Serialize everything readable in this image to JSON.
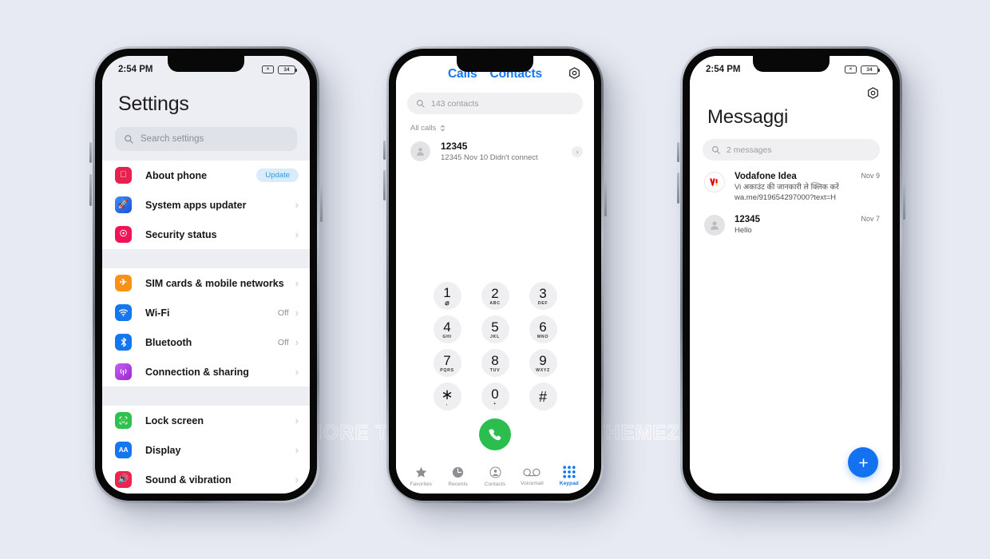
{
  "background_color": "#e7eaf2",
  "watermark": {
    "text": "FOR MORE THEMES VISIT - MIUITHEMEZ.COM"
  },
  "phone1": {
    "status": {
      "time": "2:54 PM",
      "mute_icon": "mute-icon",
      "battery_level": "34"
    },
    "title": "Settings",
    "search": {
      "placeholder": "Search settings",
      "icon": "search-icon"
    },
    "groups": [
      {
        "items": [
          {
            "label": "About phone",
            "icon": "apple-icon",
            "icon_color": "#e8204e",
            "badge": "Update",
            "chevron": false
          },
          {
            "label": "System apps updater",
            "icon": "rocket-icon",
            "icon_color": "#2d6ff0",
            "value": "",
            "chevron": true
          },
          {
            "label": "Security status",
            "icon": "shield-icon",
            "icon_color": "#ef1457",
            "value": "",
            "chevron": true
          }
        ]
      },
      {
        "items": [
          {
            "label": "SIM cards & mobile networks",
            "icon": "airplane-icon",
            "icon_color": "#f99116",
            "value": "",
            "chevron": true
          },
          {
            "label": "Wi-Fi",
            "icon": "wifi-icon",
            "icon_color": "#1577f0",
            "value": "Off",
            "chevron": true
          },
          {
            "label": "Bluetooth",
            "icon": "bluetooth-icon",
            "icon_color": "#1577f0",
            "value": "Off",
            "chevron": true
          },
          {
            "label": "Connection & sharing",
            "icon": "broadcast-icon",
            "icon_color": "#b63ce0",
            "value": "",
            "chevron": true
          }
        ]
      },
      {
        "items": [
          {
            "label": "Lock screen",
            "icon": "face-id-icon",
            "icon_color": "#2fc14e",
            "value": "",
            "chevron": true
          },
          {
            "label": "Display",
            "icon": "text-size-icon",
            "icon_color": "#1577f0",
            "value": "",
            "chevron": true
          },
          {
            "label": "Sound & vibration",
            "icon": "speaker-icon",
            "icon_color": "#f0234e",
            "value": "",
            "chevron": true
          }
        ]
      }
    ]
  },
  "phone2": {
    "tabs": [
      {
        "label": "Calls"
      },
      {
        "label": "Contacts"
      }
    ],
    "settings_icon": "gear-icon",
    "search": {
      "placeholder": "143 contacts",
      "icon": "search-icon"
    },
    "filter": {
      "label": "All calls",
      "icon": "sort-chevrons-icon"
    },
    "calls": [
      {
        "name": "12345",
        "detail": "12345  Nov 10 Didn't connect",
        "avatar": "person-avatar-icon",
        "info": "info-chevron-icon"
      }
    ],
    "keypad": [
      {
        "num": "1",
        "sub": "⌀"
      },
      {
        "num": "2",
        "sub": "ABC"
      },
      {
        "num": "3",
        "sub": "DEF"
      },
      {
        "num": "4",
        "sub": "GHI"
      },
      {
        "num": "5",
        "sub": "JKL"
      },
      {
        "num": "6",
        "sub": "MNO"
      },
      {
        "num": "7",
        "sub": "PQRS"
      },
      {
        "num": "8",
        "sub": "TUV"
      },
      {
        "num": "9",
        "sub": "WXYZ"
      },
      {
        "num": "∗",
        "sub": ","
      },
      {
        "num": "0",
        "sub": "+"
      },
      {
        "num": "#",
        "sub": ""
      }
    ],
    "call_button": {
      "icon": "phone-handset-icon",
      "color": "#2bbe4e"
    },
    "tabbar": [
      {
        "label": "Favorites",
        "icon": "star-icon",
        "active": false
      },
      {
        "label": "Recents",
        "icon": "clock-icon",
        "active": false
      },
      {
        "label": "Contacts",
        "icon": "person-circle-icon",
        "active": false
      },
      {
        "label": "Voicemail",
        "icon": "voicemail-icon",
        "active": false
      },
      {
        "label": "Keypad",
        "icon": "keypad-grid-icon",
        "active": true
      }
    ]
  },
  "phone3": {
    "status": {
      "time": "2:54 PM",
      "mute_icon": "mute-icon",
      "battery_level": "34"
    },
    "settings_icon": "gear-icon",
    "title": "Messaggi",
    "search": {
      "placeholder": "2 messages",
      "icon": "search-icon"
    },
    "messages": [
      {
        "sender": "Vodafone Idea",
        "preview": "Vi अकाउंट की जानकारी ले क्लिक करें wa.me/919654297000?text=H",
        "date": "Nov 9",
        "avatar": "vi-logo-icon"
      },
      {
        "sender": "12345",
        "preview": "Hello",
        "date": "Nov 7",
        "avatar": "person-avatar-icon"
      }
    ],
    "fab": {
      "label": "+",
      "icon": "plus-icon",
      "color": "#1272f0"
    }
  }
}
